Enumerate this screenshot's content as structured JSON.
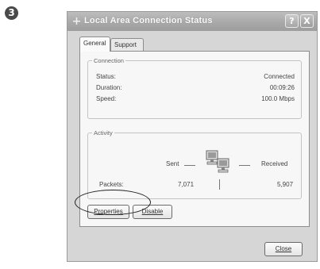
{
  "step_number": "3",
  "window": {
    "title": "Local Area Connection Status",
    "help_button": "?",
    "close_button": "X"
  },
  "tabs": [
    {
      "label": "General",
      "active": true
    },
    {
      "label": "Support",
      "active": false
    }
  ],
  "connection": {
    "legend": "Connection",
    "rows": [
      {
        "label": "Status:",
        "value": "Connected"
      },
      {
        "label": "Duration:",
        "value": "00:09:26"
      },
      {
        "label": "Speed:",
        "value": "100.0 Mbps"
      }
    ]
  },
  "activity": {
    "legend": "Activity",
    "sent_label": "Sent",
    "received_label": "Received",
    "packets_label": "Packets:",
    "packets_sent": "7,071",
    "packets_received": "5,907",
    "icon": "network-computers-icon"
  },
  "buttons": {
    "properties": "Properties",
    "disable": "Disable",
    "close": "Close"
  },
  "annotation": "highlight-ellipse around Packets row"
}
